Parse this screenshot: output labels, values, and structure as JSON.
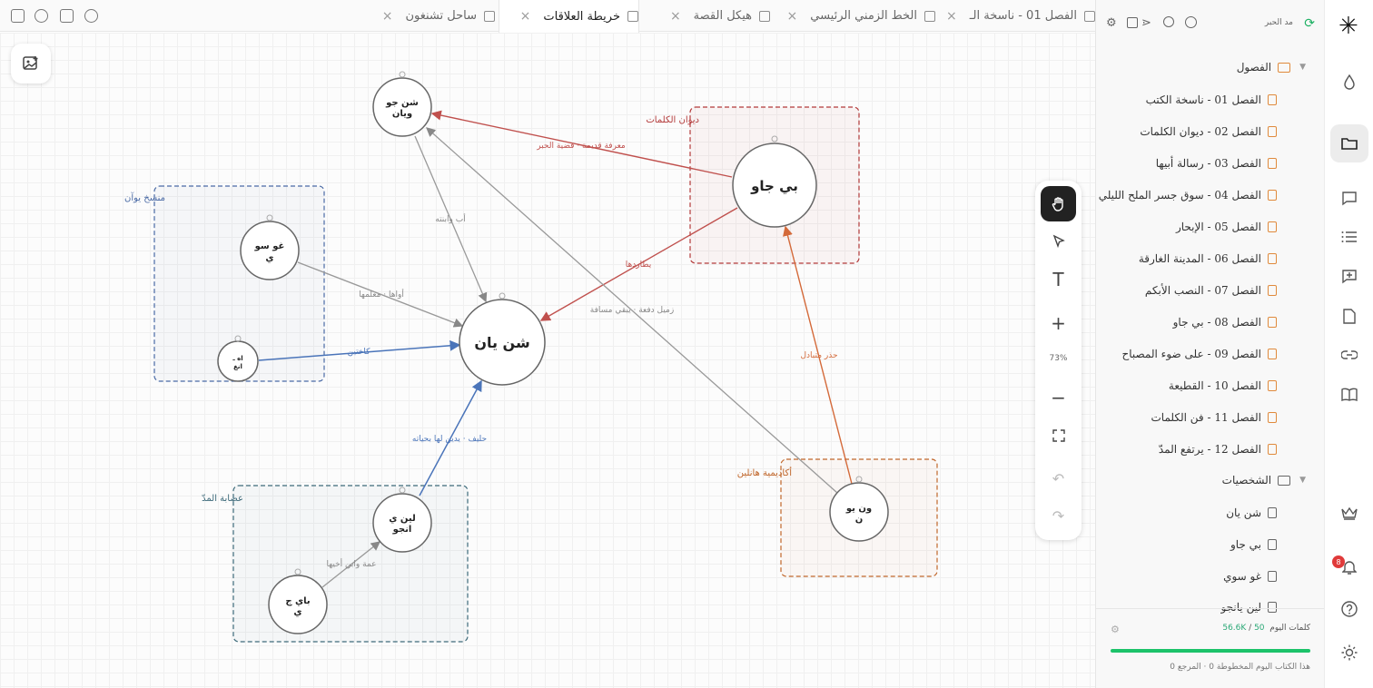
{
  "tabs": [
    {
      "label": "الفصل 01 - ناسخة الـ",
      "icon": "document-icon"
    },
    {
      "label": "الخط الزمني الرئيسي",
      "icon": "calendar-icon"
    },
    {
      "label": "هيكل القصة",
      "icon": "outline-icon"
    },
    {
      "label": "خريطة العلاقات",
      "icon": "graph-icon",
      "active": true
    },
    {
      "label": "ساحل تشنغون",
      "icon": "map-icon"
    }
  ],
  "toolbar": {
    "zoom": "73%",
    "tools": [
      "hand-icon",
      "pointer-icon",
      "text-icon",
      "zoom-in-icon",
      "zoom-out-icon",
      "fit-screen-icon",
      "undo-icon",
      "redo-icon"
    ]
  },
  "graph": {
    "nodes": [
      {
        "id": "shen-yan",
        "label": "شن يان"
      },
      {
        "id": "shen-ju-wayan",
        "label": "شن جو\nويان"
      },
      {
        "id": "bi-jaw",
        "label": "بي جاو"
      },
      {
        "id": "ghusu",
        "label": "غو سو\nي"
      },
      {
        "id": "small",
        "label": "اه ـ\nانغ"
      },
      {
        "id": "lin-yangu",
        "label": "لين ي\nانجو"
      },
      {
        "id": "bai-jy",
        "label": "باي ج\nي"
      },
      {
        "id": "wen-yu",
        "label": "ون يو\nن"
      }
    ],
    "edges": [
      {
        "label": "معرفة قديمة · قضية الحبر",
        "color": "#c0504d"
      },
      {
        "label": "أب وابنته",
        "color": "#888888"
      },
      {
        "label": "يطاردها",
        "color": "#c0504d"
      },
      {
        "label": "أواها · معلمها",
        "color": "#888888"
      },
      {
        "label": "كاختين",
        "color": "#4a74b9"
      },
      {
        "label": "زميل دفعة · يبقي مسافة",
        "color": "#888888"
      },
      {
        "label": "حليف · يدين لها بحياته",
        "color": "#4a74b9"
      },
      {
        "label": "عمة وابن أخيها",
        "color": "#888888"
      },
      {
        "label": "حذر متبادل",
        "color": "#d46a3a"
      }
    ],
    "groups": [
      {
        "label": "ديوان الكلمات",
        "color": "#b33a3a"
      },
      {
        "label": "منسخ يوآن",
        "color": "#4a6aa5"
      },
      {
        "label": "عصابة المدّ",
        "color": "#3d6a7a"
      },
      {
        "label": "أكاديمية هانلين",
        "color": "#c0662a"
      }
    ]
  },
  "sidebar": {
    "header_label": "مد الحبر",
    "header_icons": [
      "history-icon",
      "search-icon",
      "share-icon",
      "layout-icon",
      "settings-icon"
    ],
    "folder_chapters": "الفصول",
    "chapters": [
      "الفصل 01 - ناسخة الكتب",
      "الفصل 02 - ديوان الكلمات",
      "الفصل 03 - رسالة أبيها",
      "الفصل 04 - سوق جسر الملح الليلي",
      "الفصل 05 - الإبحار",
      "الفصل 06 - المدينة الغارقة",
      "الفصل 07 - النصب الأبكم",
      "الفصل 08 - بي جاو",
      "الفصل 09 - على ضوء المصباح",
      "الفصل 10 - القطيعة",
      "الفصل 11 - فن الكلمات",
      "الفصل 12 - يرتفع المدّ"
    ],
    "folder_characters": "الشخصيات",
    "characters": [
      "شن يان",
      "بي جاو",
      "غو سوي",
      "لين يانجو"
    ],
    "footer": {
      "words_label": "كلمات اليوم",
      "words_value": "50",
      "words_sep": " / ",
      "words_goal": "56.6K",
      "today_text": "هذا الكتاب اليوم  المخطوطة 0 · المرجع 0"
    }
  },
  "rail": {
    "icons": [
      "drop-icon",
      "folder-icon",
      "chat-icon",
      "list-icon",
      "add-note-icon",
      "page-icon",
      "link-icon",
      "book-icon",
      "crown-icon",
      "bell-icon",
      "help-icon",
      "sun-icon"
    ],
    "notification_count": "8"
  }
}
